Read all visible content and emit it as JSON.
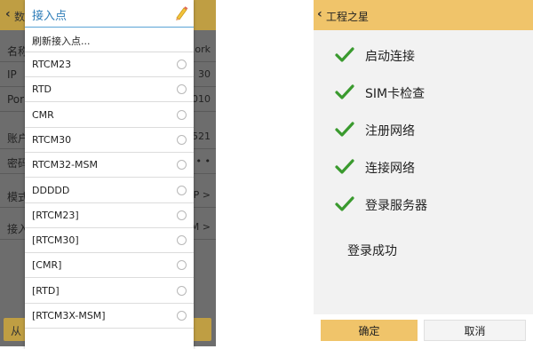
{
  "left_screen": {
    "background_header": {
      "title_fragment": "数"
    },
    "background_rows": [
      {
        "label": "名称",
        "value": "ork"
      },
      {
        "label": "IP",
        "value": "30"
      },
      {
        "label": "Por",
        "value": "010"
      },
      {
        "label": "账户",
        "value": "521"
      },
      {
        "label": "密码",
        "value": "• •"
      },
      {
        "label": "模式",
        "value": "IP >"
      },
      {
        "label": "接入",
        "value": "M >"
      }
    ],
    "background_button": "从",
    "dialog": {
      "title": "接入点",
      "edit_icon": "pencil-icon",
      "refresh_label": "刷新接入点...",
      "options": [
        "RTCM23",
        "RTD",
        "CMR",
        "RTCM30",
        "RTCM32-MSM",
        "DDDDD",
        "[RTCM23]",
        "[RTCM30]",
        "[CMR]",
        "[RTD]",
        "[RTCM3X-MSM]"
      ]
    }
  },
  "right_screen": {
    "title": "工程之星",
    "steps": [
      {
        "label": "启动连接",
        "status": "done"
      },
      {
        "label": "SIM卡检查",
        "status": "done"
      },
      {
        "label": "注册网络",
        "status": "done"
      },
      {
        "label": "连接网络",
        "status": "done"
      },
      {
        "label": "登录服务器",
        "status": "done"
      }
    ],
    "result_text": "登录成功",
    "ok_label": "确定",
    "cancel_label": "取消"
  },
  "colors": {
    "accent_yellow": "#f0c46a",
    "dialog_title_blue": "#2f7db8",
    "check_green": "#3a9a2e"
  }
}
